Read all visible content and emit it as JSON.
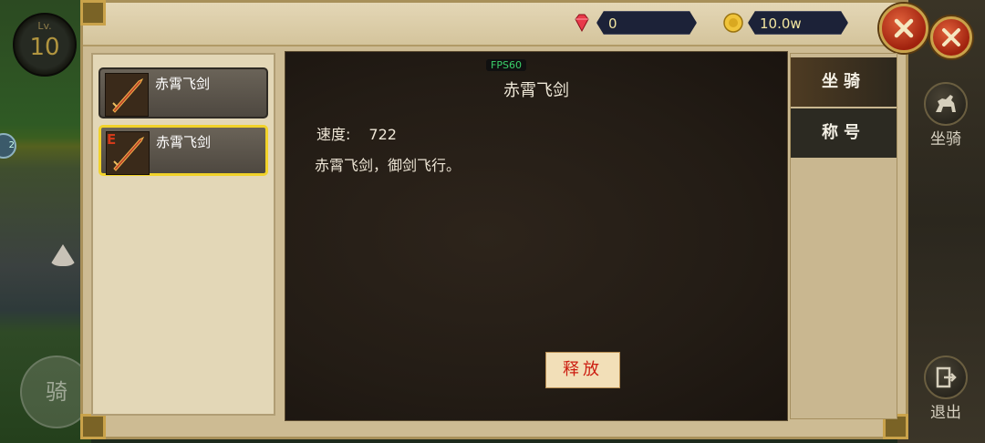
{
  "hud": {
    "level_label": "Lv.",
    "level_value": "10",
    "ride_button": "骑",
    "side_dot_text": "2"
  },
  "currency": {
    "gems": "0",
    "gold": "10.0w"
  },
  "list": {
    "items": [
      {
        "name": "赤霄飞剑",
        "tag": ""
      },
      {
        "name": "赤霄飞剑",
        "tag": "E"
      }
    ]
  },
  "detail": {
    "fps": "FPS60",
    "title": "赤霄飞剑",
    "speed_label": "速度:",
    "speed_value": "722",
    "description": "赤霄飞剑，御剑飞行。",
    "release_button": "释放"
  },
  "tabs": [
    {
      "label": "坐骑",
      "active": true
    },
    {
      "label": "称号",
      "active": false
    }
  ],
  "right_menu": {
    "mount": "坐骑",
    "exit": "退出"
  },
  "colors": {
    "accent_gold": "#c9a24a",
    "selected_border": "#f1d22a",
    "release_text": "#cc1d10"
  }
}
